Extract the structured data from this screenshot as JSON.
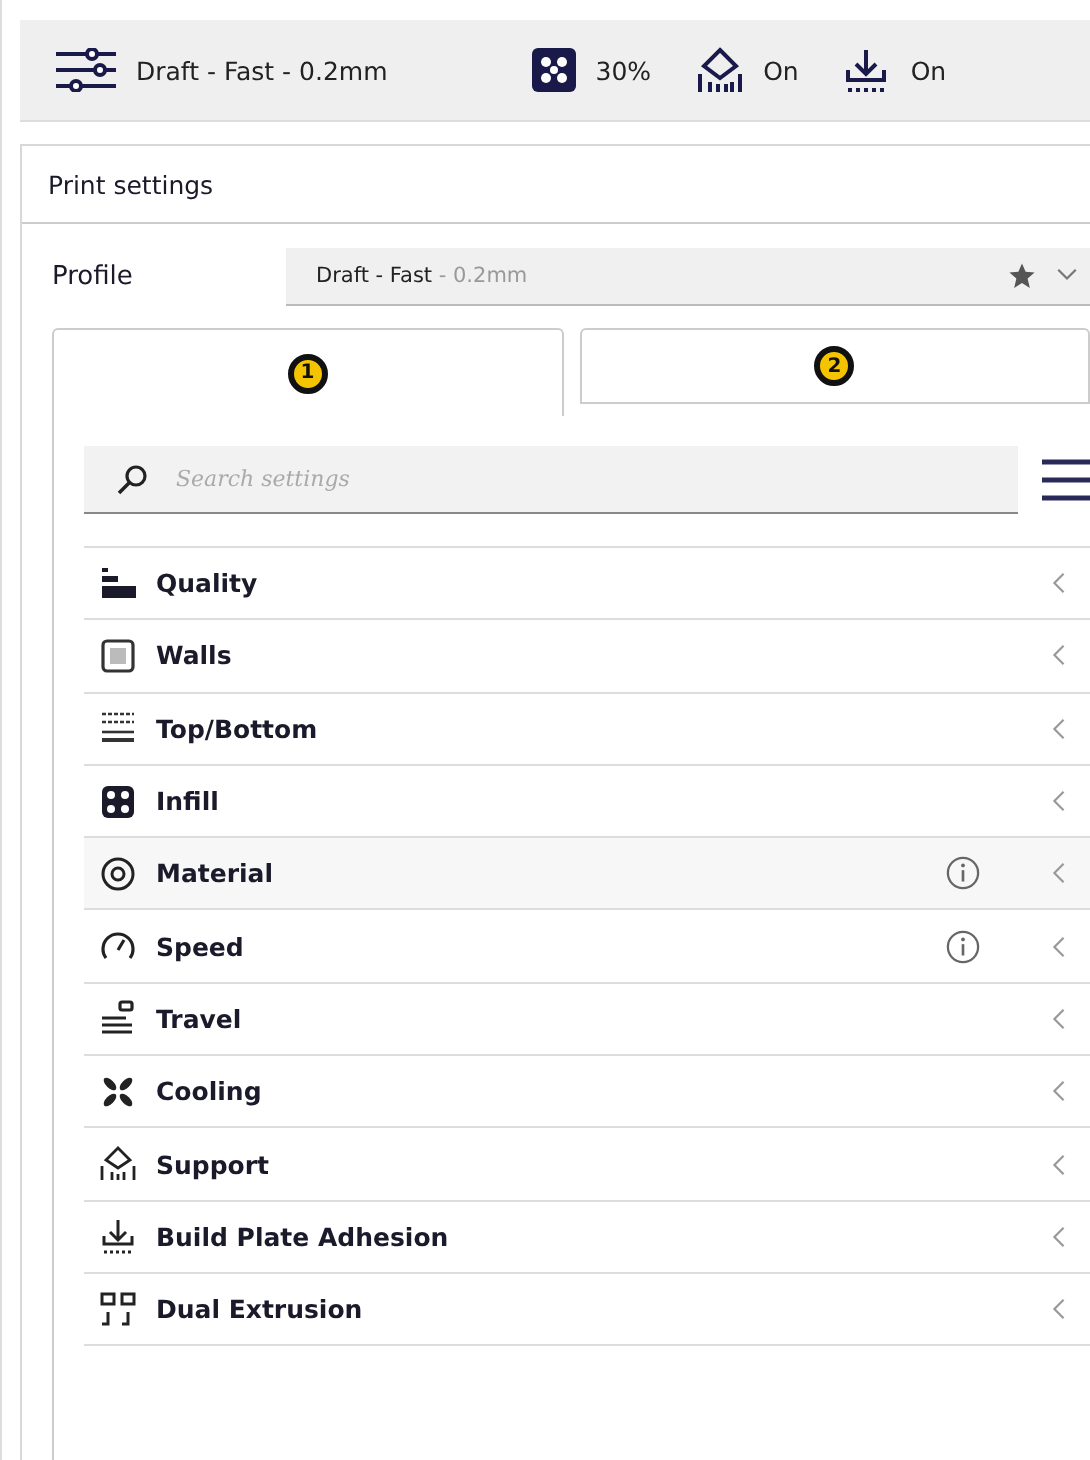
{
  "toolbar": {
    "profile": "Draft - Fast - 0.2mm",
    "infill": "30%",
    "support": "On",
    "adhesion": "On"
  },
  "panel": {
    "title": "Print settings",
    "profile": {
      "label": "Profile",
      "name": "Draft - Fast",
      "detail": " - 0.2mm"
    },
    "tabs": [
      {
        "label": "1",
        "selected": true
      },
      {
        "label": "2",
        "selected": false
      }
    ],
    "search": {
      "placeholder": "Search settings"
    },
    "categories": [
      {
        "label": "Quality",
        "info": false,
        "highlighted": false
      },
      {
        "label": "Walls",
        "info": false,
        "highlighted": false
      },
      {
        "label": "Top/Bottom",
        "info": false,
        "highlighted": false
      },
      {
        "label": "Infill",
        "info": false,
        "highlighted": false
      },
      {
        "label": "Material",
        "info": true,
        "highlighted": true
      },
      {
        "label": "Speed",
        "info": true,
        "highlighted": false
      },
      {
        "label": "Travel",
        "info": false,
        "highlighted": false
      },
      {
        "label": "Cooling",
        "info": false,
        "highlighted": false
      },
      {
        "label": "Support",
        "info": false,
        "highlighted": false
      },
      {
        "label": "Build Plate Adhesion",
        "info": false,
        "highlighted": false
      },
      {
        "label": "Dual Extrusion",
        "info": false,
        "highlighted": false
      }
    ]
  }
}
